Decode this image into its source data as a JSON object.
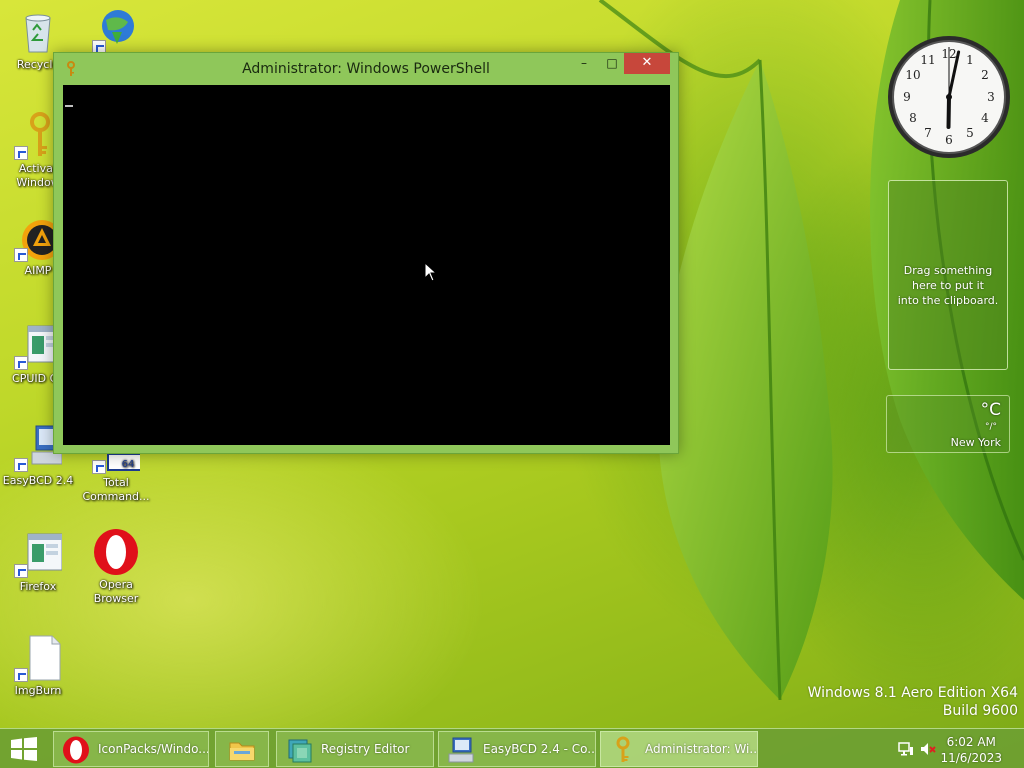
{
  "desktop": {
    "icons": [
      {
        "label": "Recycle"
      },
      {
        "label": ""
      },
      {
        "label": "Activat\nWindow"
      },
      {
        "label": "AIMP"
      },
      {
        "label": "CPUID CP"
      },
      {
        "label": "EasyBCD 2.4"
      },
      {
        "label": "Total\nCommand..."
      },
      {
        "label": "Firefox"
      },
      {
        "label": "Opera\nBrowser"
      },
      {
        "label": "ImgBurn"
      }
    ],
    "watermark": {
      "line1": "Windows 8.1 Aero Edition X64",
      "line2": "Build 9600"
    }
  },
  "window": {
    "title": "Administrator: Windows PowerShell",
    "minimize_glyph": "–",
    "maximize_glyph": "□",
    "close_glyph": "✕"
  },
  "gadgets": {
    "clock": {
      "hour": 6,
      "minute": 2,
      "second": 0
    },
    "clipboard": {
      "line1": "Drag something",
      "line2": "here to put it",
      "line3": "into the clipboard."
    },
    "weather": {
      "temp": "°C",
      "range": "°/°",
      "city": "New York"
    }
  },
  "taskbar": {
    "items": [
      {
        "label": "IconPacks/Windo..."
      },
      {
        "label": ""
      },
      {
        "label": "Registry Editor"
      },
      {
        "label": "EasyBCD 2.4 - Co..."
      },
      {
        "label": "Administrator: Wi..."
      }
    ],
    "time": "6:02 AM",
    "date": "11/6/2023"
  }
}
